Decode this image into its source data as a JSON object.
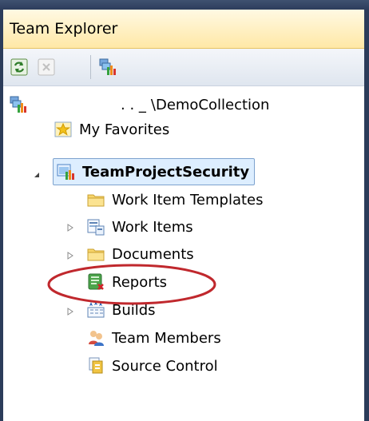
{
  "window": {
    "title": "Team Explorer"
  },
  "toolbar": {
    "buttons": [
      {
        "name": "refresh-button",
        "icon": "refresh-icon"
      },
      {
        "name": "stop-button",
        "icon": "stop-icon"
      },
      {
        "name": "add-project-button",
        "icon": "add-team-project-icon"
      }
    ]
  },
  "tree": {
    "server_label": "\\DemoCollection",
    "server_mask": ". . _",
    "favorites_label": "My Favorites",
    "project_label": "TeamProjectSecurity",
    "children": {
      "work_item_templates": "Work Item Templates",
      "work_items": "Work Items",
      "documents": "Documents",
      "reports": "Reports",
      "builds": "Builds",
      "team_members": "Team Members",
      "source_control": "Source Control"
    }
  },
  "colors": {
    "accent": "#ffe8a6",
    "selection": "#ddeeff",
    "annotation": "#c0282d"
  }
}
